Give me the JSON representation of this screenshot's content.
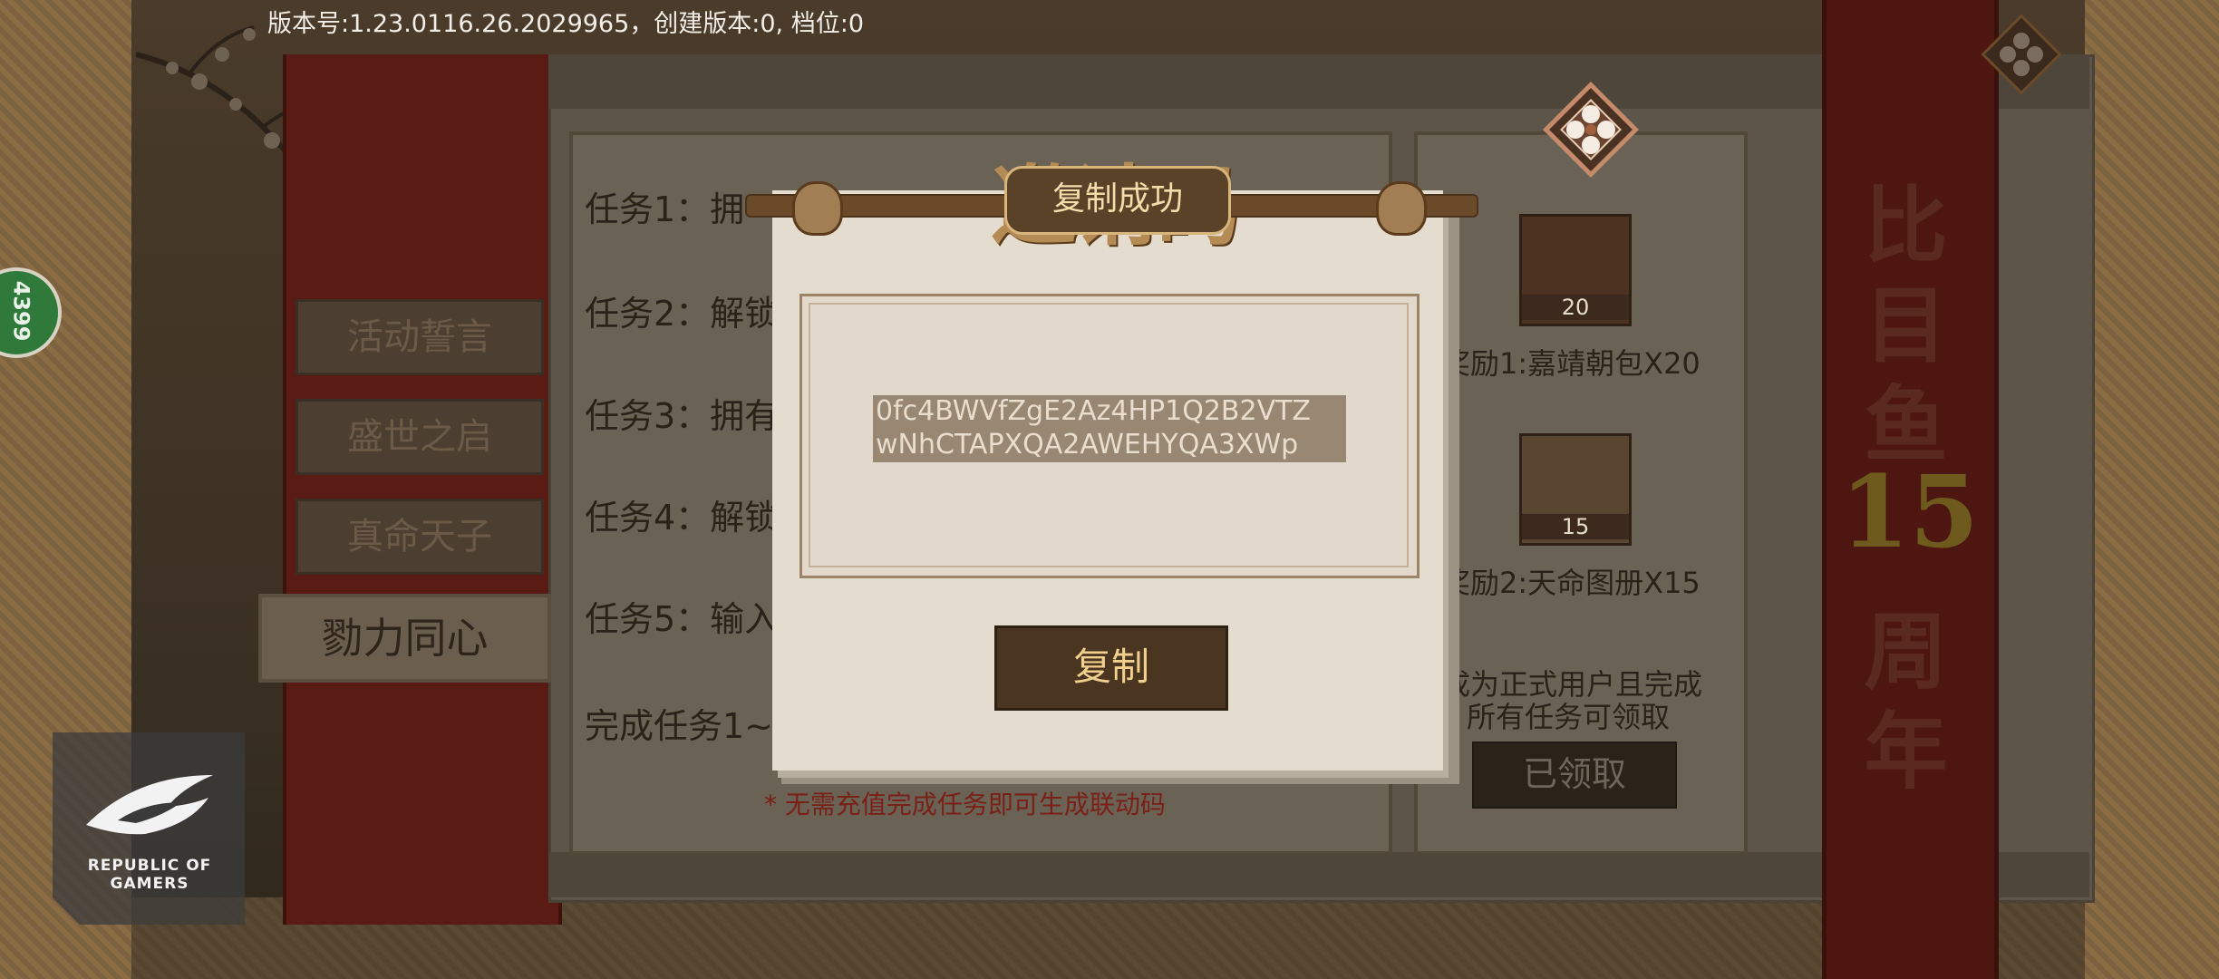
{
  "status": {
    "version_text": "版本号:1.23.0116.26.2029965，创建版本:0, 档位:0"
  },
  "side_tabs": [
    {
      "label": "活动誓言"
    },
    {
      "label": "盛世之启"
    },
    {
      "label": "真命天子"
    },
    {
      "label": "勠力同心"
    }
  ],
  "tasks": [
    {
      "label": "任务1：拥"
    },
    {
      "label": "任务2：解锁"
    },
    {
      "label": "任务3：拥有"
    },
    {
      "label": "任务4：解锁"
    },
    {
      "label": "任务5：输入"
    }
  ],
  "task_footer": "完成任务1~",
  "notice": "* 无需充值完成任务即可生成联动码",
  "rewards": [
    {
      "count": "20",
      "label": "奖励1:嘉靖朝包X20"
    },
    {
      "count": "15",
      "label": "奖励2:天命图册X15"
    }
  ],
  "reward_condition_line1": "成为正式用户且完成",
  "reward_condition_line2": "所有任务可领取",
  "claimed_label": "已领取",
  "banner": {
    "chars": [
      "比",
      "目",
      "鱼",
      "周",
      "年"
    ],
    "number": "15"
  },
  "popup": {
    "title_art": "邀请码",
    "code_line1": "0fc4BWVfZgE2Az4HP1Q2B2VTZ",
    "code_line2": "wNhCTAPXQA2AWEHYQA3XWp",
    "copy_label": "复制"
  },
  "toast": "复制成功",
  "badge_text": "4399",
  "rog": {
    "line1": "REPUBLIC OF",
    "line2": "GAMERS"
  },
  "colors": {
    "banner_red": "#4d1610",
    "toast_border": "#d8b57a",
    "copy_button_bg": "#4a3520",
    "code_highlight": "#978773"
  },
  "icons": [
    "flower-close-icon",
    "flower-menu-icon",
    "rog-eye-icon",
    "scroll-knob-icon"
  ]
}
